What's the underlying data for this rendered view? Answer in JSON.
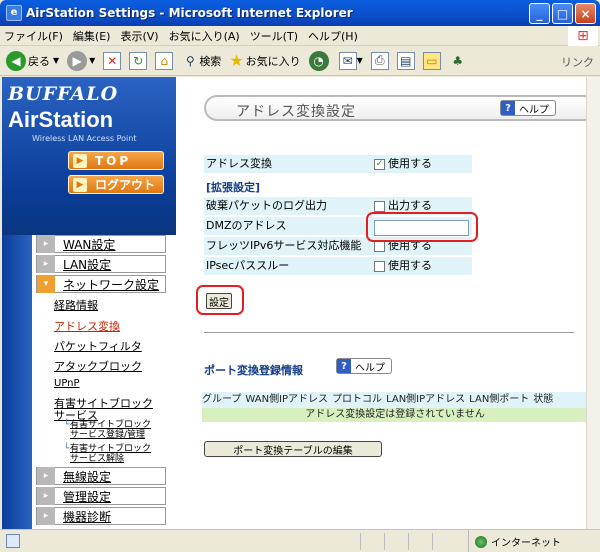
{
  "window": {
    "title": "AirStation Settings - Microsoft Internet Explorer",
    "app_icon": "ie-icon"
  },
  "menubar": {
    "items": [
      "ファイル(F)",
      "編集(E)",
      "表示(V)",
      "お気に入り(A)",
      "ツール(T)",
      "ヘルプ(H)"
    ]
  },
  "toolbar": {
    "back_label": "戻る",
    "search_label": "検索",
    "favorites_label": "お気に入り",
    "links_label": "リンク"
  },
  "sidebar": {
    "brand": "BUFFALO",
    "product": "AirStation",
    "product_sub": "Wireless LAN Access Point",
    "top_button": "TOP",
    "logout_button": "ログアウト",
    "nav": {
      "wan": "WAN設定",
      "lan": "LAN設定",
      "network": "ネットワーク設定",
      "wireless": "無線設定",
      "admin": "管理設定",
      "diag": "機器診断"
    },
    "sub": {
      "routing": "経路情報",
      "address_translation": "アドレス変換",
      "packet_filter": "パケットフィルタ",
      "attack_block": "アタックブロック",
      "upnp": "UPnP",
      "harmful_site_1": "有害サイトブロック",
      "harmful_site_2": "サービス",
      "sub1_line1": "有害サイトブロック",
      "sub1_line2": "サービス登録/管理",
      "sub2_line1": "有害サイトブロック",
      "sub2_line2": "サービス解除"
    }
  },
  "main": {
    "page_title": "アドレス変換設定",
    "help_label": "ヘルプ",
    "rows": {
      "addr_trans_label": "アドレス変換",
      "addr_trans_value": "使用する",
      "extended_header": "[拡張設定]",
      "discard_log_label": "破棄パケットのログ出力",
      "discard_log_value": "出力する",
      "dmz_label": "DMZのアドレス",
      "dmz_value": "",
      "flets_label": "フレッツIPv6サービス対応機能",
      "flets_value": "使用する",
      "ipsec_label": "IPsecパススルー",
      "ipsec_value": "使用する"
    },
    "set_button": "設定",
    "port": {
      "title": "ポート変換登録情報",
      "help_label": "ヘルプ",
      "columns": [
        "グループ",
        "WAN側IPアドレス",
        "プロトコル",
        "LAN側IPアドレス",
        "LAN側ポート",
        "状態"
      ],
      "empty_message": "アドレス変換設定は登録されていません",
      "edit_button": "ポート変換テーブルの編集"
    }
  },
  "statusbar": {
    "zone_label": "インターネット"
  },
  "colors": {
    "title_bar": "#0c4ec9",
    "sidebar_blue": "#0b3d99",
    "highlight_red": "#e02020",
    "row_bg": "#dff3f8",
    "empty_row_bg": "#d8f0c0"
  }
}
